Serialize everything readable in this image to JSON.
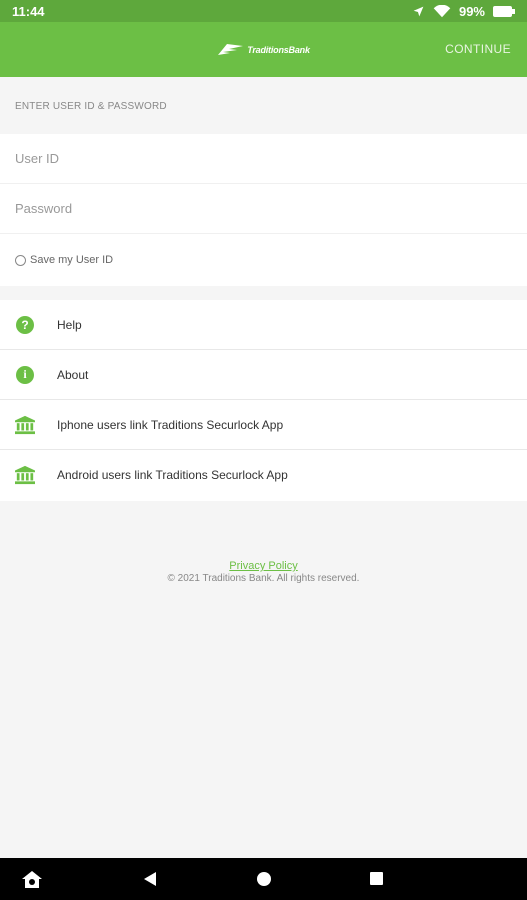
{
  "status_bar": {
    "time": "11:44",
    "battery": "99%"
  },
  "app_bar": {
    "logo_text": "TraditionsBank",
    "continue_label": "CONTINUE"
  },
  "login": {
    "section_header": "ENTER USER ID & PASSWORD",
    "userid_placeholder": "User ID",
    "password_placeholder": "Password",
    "save_label": "Save my User ID"
  },
  "menu": {
    "items": [
      {
        "label": "Help",
        "icon": "question-icon"
      },
      {
        "label": "About",
        "icon": "info-icon"
      },
      {
        "label": "Iphone users link Traditions Securlock App",
        "icon": "bank-icon"
      },
      {
        "label": "Android users link Traditions Securlock App",
        "icon": "bank-icon"
      }
    ]
  },
  "footer": {
    "privacy_link": "Privacy Policy",
    "copyright": "© 2021 Traditions Bank. All rights reserved."
  },
  "colors": {
    "accent": "#6cbf45",
    "status_bar": "#5ea83c"
  }
}
